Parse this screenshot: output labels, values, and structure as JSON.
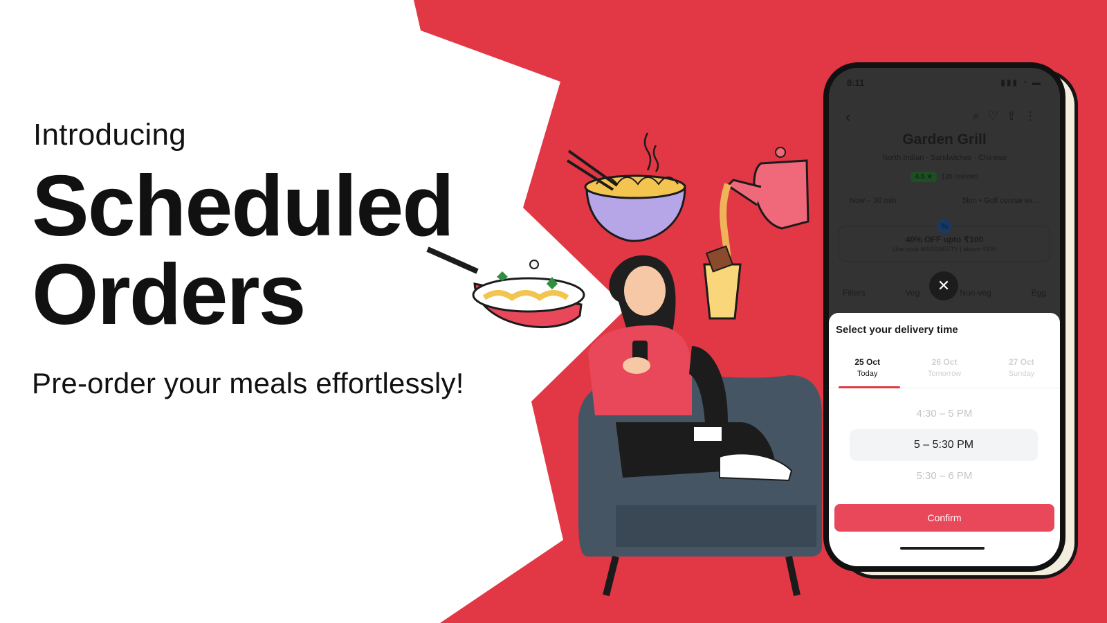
{
  "hero": {
    "intro": "Introducing",
    "title_line1": "Scheduled",
    "title_line2": "Orders",
    "subtitle": "Pre-order your meals effortlessly!"
  },
  "colors": {
    "brand_red": "#e23744",
    "background": "#ffffff",
    "text": "#111111",
    "chair": "#455563"
  },
  "phone": {
    "status_time": "8:11",
    "restaurant": {
      "name": "Garden Grill",
      "cuisine": "North Indian · Sandwiches · Chinese",
      "rating": "4.5 ★",
      "reviews": "135 reviews",
      "eta": "Now – 30 min",
      "distance": "5km • Golf course ex..."
    },
    "offer": {
      "title": "40% OFF upto ₹100",
      "subtitle": "Use code MASSAFETY | above ₹100"
    },
    "filters": [
      "Filters",
      "Veg",
      "Non-veg",
      "Egg"
    ],
    "close_symbol": "✕",
    "sheet": {
      "title": "Select your delivery time",
      "dates": [
        {
          "date": "25 Oct",
          "day": "Today"
        },
        {
          "date": "26 Oct",
          "day": "Tomorrow"
        },
        {
          "date": "27 Oct",
          "day": "Sunday"
        }
      ],
      "selected_date_index": 0,
      "slots": [
        "4:30 – 5 PM",
        "5 – 5:30 PM",
        "5:30 – 6 PM"
      ],
      "selected_slot_index": 1,
      "confirm_label": "Confirm"
    }
  }
}
